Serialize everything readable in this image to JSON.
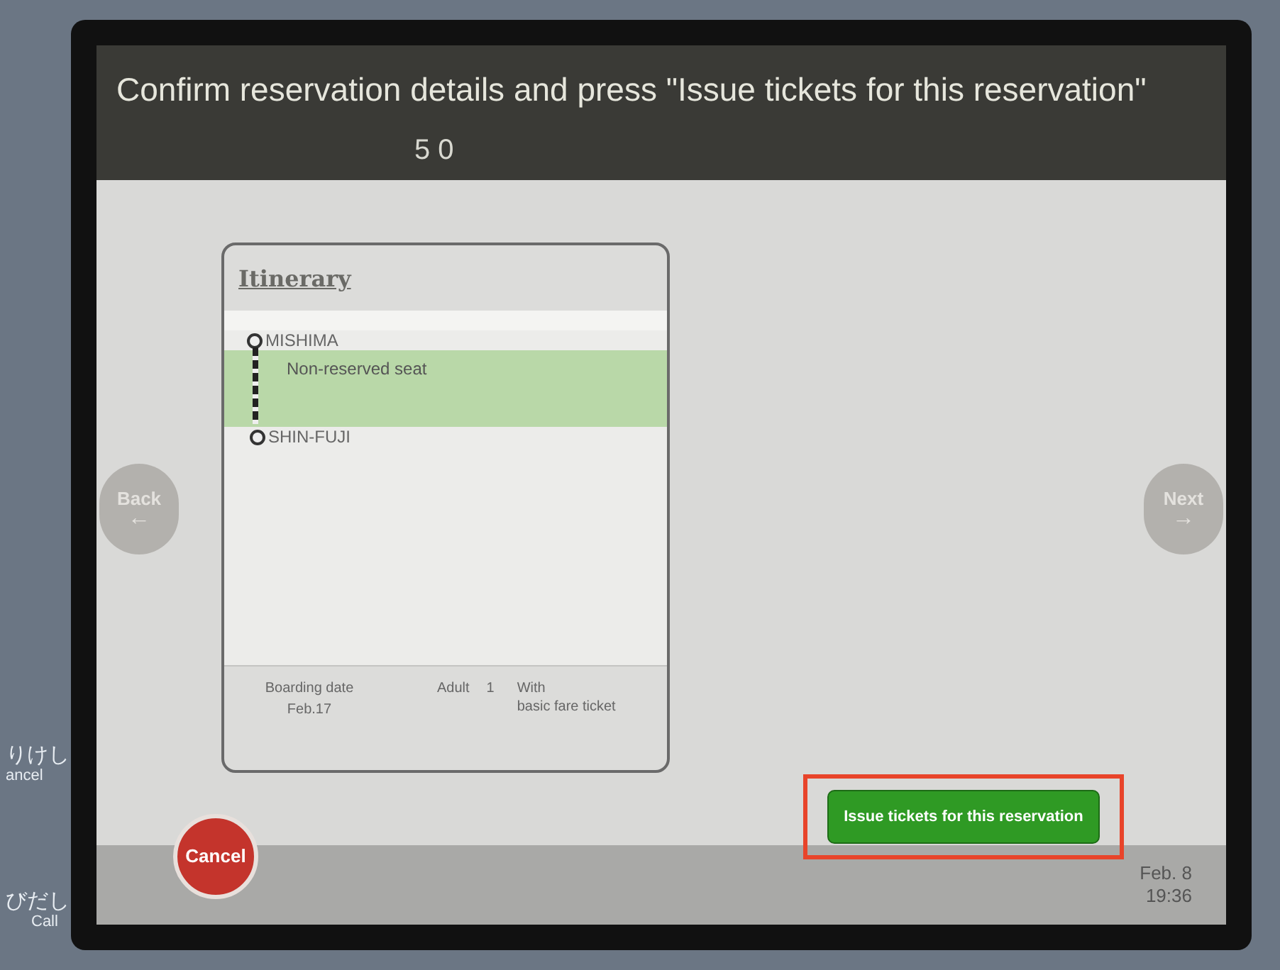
{
  "header": {
    "instruction": "Confirm reservation details and press \"Issue tickets for this reservation\"",
    "reservation_number": "5 0"
  },
  "itinerary": {
    "title": "Itinerary",
    "from": "MISHIMA",
    "seat": "Non-reserved seat",
    "to": "SHIN-FUJI",
    "footer": {
      "boarding_label": "Boarding date",
      "boarding_date": "Feb.17",
      "passenger": "Adult",
      "count": "1",
      "ticket_line_1": "With",
      "ticket_line_2": "basic fare ticket"
    }
  },
  "nav": {
    "back": "Back",
    "back_arrow": "←",
    "next": "Next",
    "next_arrow": "→"
  },
  "issue_button": "Issue tickets for this reservation",
  "cancel_button": "Cancel",
  "clock": {
    "date": "Feb. 8",
    "time": "19:36"
  },
  "bezel_labels": [
    {
      "jp": "りけし",
      "en": "ancel"
    },
    {
      "jp": "びだし",
      "en": "Call"
    }
  ]
}
